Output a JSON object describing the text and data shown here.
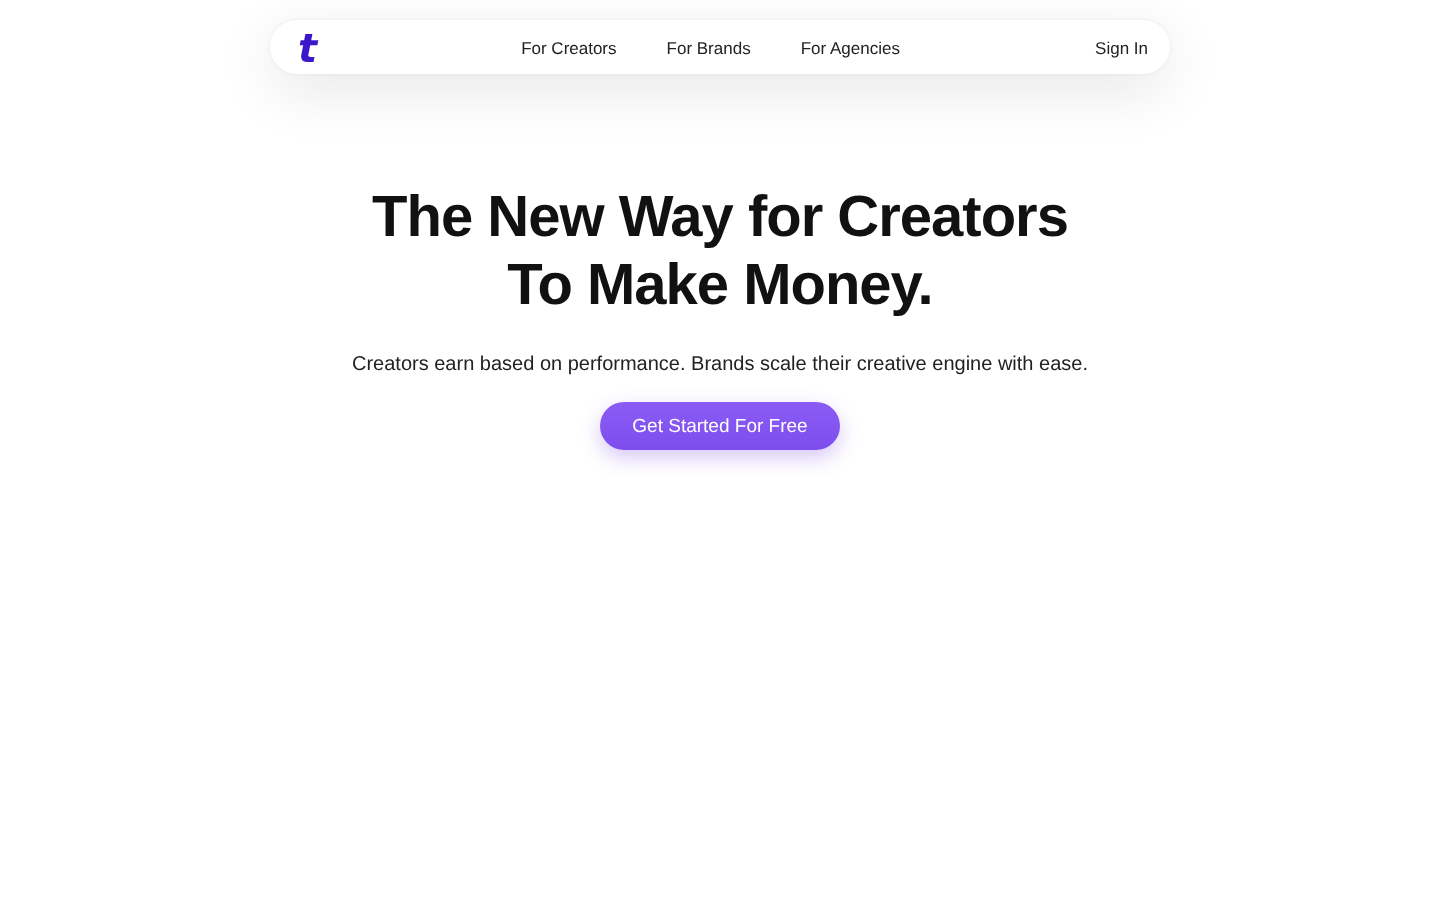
{
  "nav": {
    "logo": "t",
    "links": [
      {
        "label": "For Creators"
      },
      {
        "label": "For Brands"
      },
      {
        "label": "For Agencies"
      }
    ],
    "sign_in": "Sign In"
  },
  "hero": {
    "title_lines": [
      "The New Way for Creators",
      "To Make Money."
    ],
    "subtitle": "Creators earn based on performance. Brands scale their creative engine with ease.",
    "cta": "Get Started For Free"
  }
}
